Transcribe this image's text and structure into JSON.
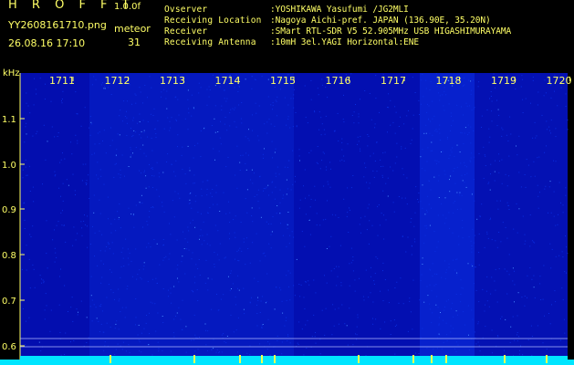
{
  "header": {
    "app_title": "H R O F F T",
    "version": "1.0.0f",
    "filename": "YY2608161710.png",
    "datetime": "26.08.16 17:10",
    "meteor_label": "meteor",
    "meteor_count": "31"
  },
  "info": [
    {
      "key": "Ovserver",
      "value": ":YOSHIKAWA Yasufumi /JG2MLI"
    },
    {
      "key": "Receiving Location",
      "value": ":Nagoya Aichi-pref. JAPAN (136.90E, 35.20N)"
    },
    {
      "key": "Receiver",
      "value": ":SMart RTL-SDR V5 52.905MHz USB HIGASHIMURAYAMA"
    },
    {
      "key": "Receiving Antenna",
      "value": ":10mH 3el.YAGI Horizontal:ENE"
    }
  ],
  "axis": {
    "y_unit": "kHz",
    "y_ticks": [
      "1.1",
      "1.0",
      "0.9",
      "0.8",
      "0.7",
      "0.6"
    ],
    "x_ticks": [
      "1711",
      "1712",
      "1713",
      "1714",
      "1715",
      "1716",
      "1717",
      "1718",
      "1719",
      "1720"
    ]
  },
  "colors": {
    "text": "#ffff66",
    "background": "#000000",
    "noise_dark": "#00009a",
    "noise_mid": "#0a2ee0",
    "noise_bright": "#4a8cff",
    "baseline": "#00e5ff"
  }
}
